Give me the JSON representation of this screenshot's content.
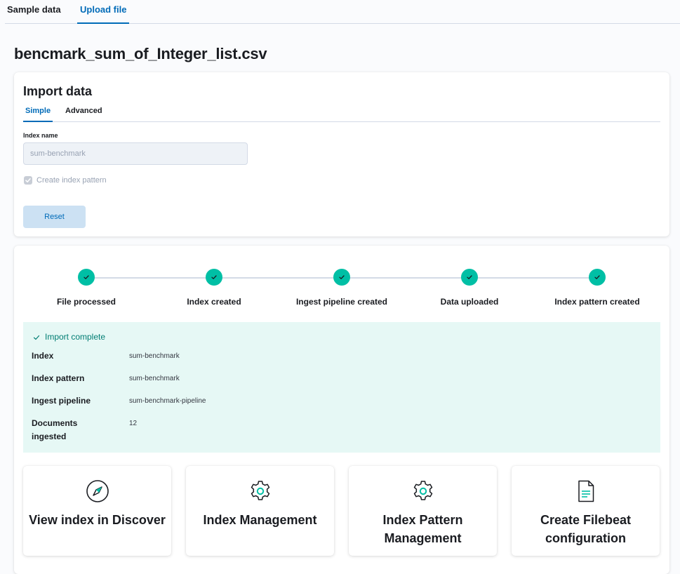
{
  "tabs": [
    {
      "label": "Sample data",
      "active": false
    },
    {
      "label": "Upload file",
      "active": true
    }
  ],
  "file_name": "bencmark_sum_of_Integer_list.csv",
  "import": {
    "title": "Import data",
    "tabs": [
      {
        "label": "Simple",
        "active": true
      },
      {
        "label": "Advanced",
        "active": false
      }
    ],
    "index_name_label": "Index name",
    "index_name_value": "sum-benchmark",
    "create_index_pattern_label": "Create index pattern",
    "create_index_pattern_checked": true,
    "reset_label": "Reset"
  },
  "steps": [
    {
      "label": "File processed",
      "status": "complete"
    },
    {
      "label": "Index created",
      "status": "complete"
    },
    {
      "label": "Ingest pipeline created",
      "status": "complete"
    },
    {
      "label": "Data uploaded",
      "status": "complete"
    },
    {
      "label": "Index pattern created",
      "status": "complete"
    }
  ],
  "result": {
    "title": "Import complete",
    "rows": [
      {
        "term": "Index",
        "value": "sum-benchmark"
      },
      {
        "term": "Index pattern",
        "value": "sum-benchmark"
      },
      {
        "term": "Ingest pipeline",
        "value": "sum-benchmark-pipeline"
      },
      {
        "term": "Documents ingested",
        "value": "12"
      }
    ]
  },
  "cards": [
    {
      "title": "View index in Discover",
      "icon": "compass-icon"
    },
    {
      "title": "Index Management",
      "icon": "gear-icon"
    },
    {
      "title": "Index Pattern Management",
      "icon": "gear-icon"
    },
    {
      "title": "Create Filebeat configuration",
      "icon": "document-icon"
    }
  ],
  "colors": {
    "accent": "#006bb8",
    "success": "#00bfa5",
    "success_text": "#017d73",
    "callout_bg": "#e6f8f5"
  }
}
